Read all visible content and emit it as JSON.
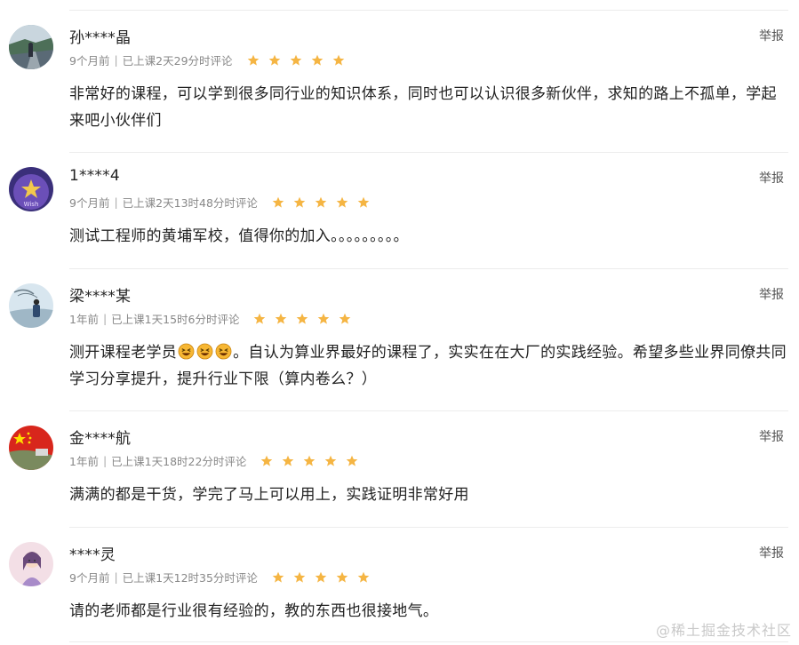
{
  "reviews": [
    {
      "username": "孙****晶",
      "time_ago": "9个月前",
      "study_info": "已上课2天29分时评论",
      "rating": 5,
      "report_label": "举报",
      "content": "非常好的课程，可以学到很多同行业的知识体系，同时也可以认识很多新伙伴，求知的路上不孤单，学起来吧小伙伴们",
      "avatar": "road-photo-avatar"
    },
    {
      "username": "1****4",
      "time_ago": "9个月前",
      "study_info": "已上课2天13时48分时评论",
      "rating": 5,
      "report_label": "举报",
      "content": "测试工程师的黄埔军校，值得你的加入。。。。。。。。。",
      "avatar": "purple-wish-avatar"
    },
    {
      "username": "梁****某",
      "time_ago": "1年前",
      "study_info": "已上课1天15时6分时评论",
      "rating": 5,
      "report_label": "举报",
      "content_before_emoji": "测开课程老学员",
      "emoji_count": 3,
      "emoji_name": "laughing-emoji",
      "content_after_emoji": "。自认为算业界最好的课程了，实实在在大厂的实践经验。希望多些业界同僚共同学习分享提升，提升行业下限（算内卷么？）",
      "avatar": "sky-person-avatar"
    },
    {
      "username": "金****航",
      "time_ago": "1年前",
      "study_info": "已上课1天18时22分时评论",
      "rating": 5,
      "report_label": "举报",
      "content": "满满的都是干货，学完了马上可以用上，实践证明非常好用",
      "avatar": "flag-avatar"
    },
    {
      "username": "****灵",
      "time_ago": "9个月前",
      "study_info": "已上课1天12时35分时评论",
      "rating": 5,
      "report_label": "举报",
      "content": "请的老师都是行业很有经验的，教的东西也很接地气。",
      "avatar": "anime-girl-avatar"
    }
  ],
  "watermark": "@稀土掘金技术社区",
  "colors": {
    "star": "#F5B543",
    "text": "#222222",
    "meta": "#888888",
    "divider": "#ECECEC"
  }
}
